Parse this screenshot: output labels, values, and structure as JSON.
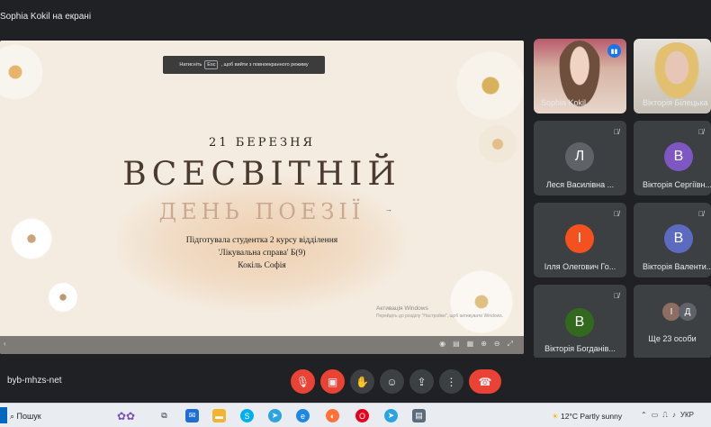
{
  "meeting": {
    "presenter_banner": "Sophia Kokil на екрані",
    "meeting_code": "byb-mhzs-net"
  },
  "slide": {
    "esc_prefix": "Натисніть",
    "esc_key": "Esc",
    "esc_suffix": ", щоб вийти з повноекранного режиму",
    "date": "21 БЕРЕЗНЯ",
    "title": "ВСЕСВІТНІЙ",
    "subtitle": "ДЕНЬ ПОЕЗІЇ",
    "credit_line1": "Підготувала студентка 2 курсу  відділення",
    "credit_line2": "'Лікувальна справа' Б(9)",
    "credit_line3": "Кокіль Софія",
    "activate_title": "Активація Windows",
    "activate_sub": "Перейдіть до розділу \"Настройки\", щоб активувати Windows.",
    "colors": {
      "background": "#f4ece0",
      "title": "#4b3a2e",
      "subtitle": "#c9a992"
    }
  },
  "participants": [
    {
      "name": "Sophia Kokil",
      "type": "video",
      "speaking": true
    },
    {
      "name": "Вікторія Білецька",
      "type": "video"
    },
    {
      "name": "Леся Василівна ...",
      "initial": "Л",
      "color": "#5f6368",
      "muted": true
    },
    {
      "name": "Вікторія Сергіївн...",
      "initial": "В",
      "color": "#7e57c2",
      "muted": true
    },
    {
      "name": "Ілля Олегович Го...",
      "initial": "І",
      "color": "#f4511e",
      "muted": true
    },
    {
      "name": "Вікторія Валенти...",
      "initial": "В",
      "color": "#5c6bc0",
      "muted": true
    },
    {
      "name": "Вікторія Богданів...",
      "initial": "В",
      "color": "#33691e",
      "muted": true
    },
    {
      "name": "Ще 23 особи",
      "initials": [
        "І",
        "Д"
      ]
    }
  ],
  "taskbar": {
    "search_label": "Пошук",
    "weather": "12°C  Partly sunny",
    "tray_lang": "УКР"
  }
}
